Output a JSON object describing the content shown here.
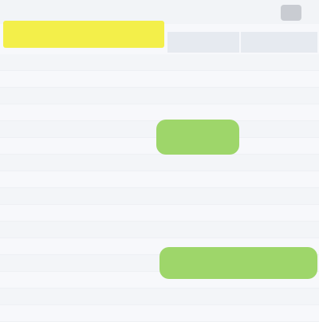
{
  "title": "",
  "columns": [
    "",
    ""
  ],
  "rows": [
    {
      "a": "",
      "b": "",
      "c": "",
      "d": ""
    },
    {
      "a": "",
      "b": "",
      "c": "",
      "d": ""
    },
    {
      "a": "",
      "b": "",
      "c": "",
      "d": ""
    },
    {
      "a": "",
      "b": "",
      "c": "",
      "d": ""
    },
    {
      "a": "",
      "b": "",
      "c": "",
      "d": ""
    },
    {
      "a": "",
      "b": "",
      "c": "",
      "d": ""
    },
    {
      "a": "",
      "b": "",
      "c": "",
      "d": ""
    },
    {
      "a": "",
      "b": "",
      "c": "",
      "d": ""
    },
    {
      "a": "",
      "b": "",
      "c": "",
      "d": ""
    },
    {
      "a": "",
      "b": "",
      "c": "",
      "d": ""
    },
    {
      "a": "",
      "b": "",
      "c": "",
      "d": ""
    },
    {
      "a": "",
      "b": "",
      "c": "",
      "d": ""
    },
    {
      "a": "",
      "b": "",
      "c": "",
      "d": ""
    },
    {
      "a": "",
      "b": "",
      "c": "",
      "d": ""
    },
    {
      "a": "",
      "b": "",
      "c": "",
      "d": ""
    },
    {
      "a": "",
      "b": "",
      "c": "",
      "d": ""
    }
  ],
  "highlights": [
    "",
    ""
  ],
  "colors": {
    "title_fill": "#f3ef4a",
    "highlight_fill": "#9ed66a",
    "header_fill": "#e6eaf0"
  },
  "icons": {
    "corner": "window-control-icon"
  }
}
